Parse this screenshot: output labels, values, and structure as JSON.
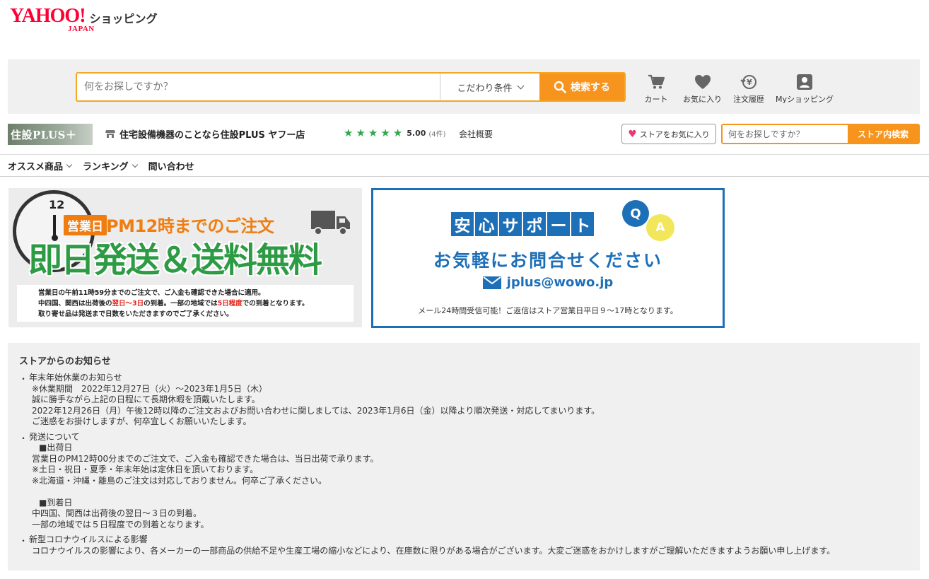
{
  "header": {
    "logo_main": "YAHOO!",
    "logo_sub": "JAPAN",
    "logo_shopping": "ショッピング"
  },
  "search": {
    "placeholder": "何をお探しですか？",
    "conditions_label": "こだわり条件",
    "button_label": "検索する"
  },
  "header_icons": [
    {
      "icon": "cart-icon",
      "label": "カート"
    },
    {
      "icon": "heart-icon",
      "label": "お気に入り"
    },
    {
      "icon": "order-history-icon",
      "label": "注文履歴"
    },
    {
      "icon": "user-icon",
      "label": "Myショッピング"
    }
  ],
  "store": {
    "logo_text": "住設PLUS＋",
    "name": "住宅設備機器のことなら住設PLUS ヤフー店",
    "rating": "5.00",
    "review_count": "(4件)",
    "company_link": "会社概要",
    "favorite_label": "ストアをお気に入り",
    "search_placeholder": "何をお探しですか？",
    "search_button": "ストア内検索"
  },
  "nav": {
    "items": [
      {
        "label": "オススメ商品",
        "dropdown": true
      },
      {
        "label": "ランキング",
        "dropdown": true
      },
      {
        "label": "問い合わせ",
        "dropdown": false
      }
    ]
  },
  "banner1": {
    "clock_12": "12",
    "badge": "営業日",
    "headline": "PM12時までのご注文",
    "big": "即日発送＆送料無料",
    "note1": "営業日の午前11時59分までのご注文で、ご入金も確認できた場合に適用。",
    "note2_a": "中四国、関西は出荷後の",
    "note2_b": "翌日～3日",
    "note2_c": "の到着。一部の地域では",
    "note2_d": "5日程度",
    "note2_e": "での到着となります。",
    "note3": "取り寄せ品は発送まで日数をいただきますのでご了承ください。"
  },
  "banner2": {
    "title_chars": [
      "安",
      "心",
      "サ",
      "ポ",
      "ー",
      "ト"
    ],
    "q": "Q",
    "a": "A",
    "subtitle": "お気軽にお問合せください",
    "email": "jplus@wowo.jp",
    "note": "メール24時間受信可能！ご返信はストア営業日平日９～17時となります。"
  },
  "notice": {
    "title": "ストアからのお知らせ",
    "item1": {
      "l1": "年末年始休業のお知らせ",
      "l2": "※休業期間　2022年12月27日（火）～2023年1月5日（木）",
      "l3": "誠に勝手ながら上記の日程にて長期休暇を頂戴いたします。",
      "l4": "2022年12月26日（月）午後12時以降のご注文およびお問い合わせに関しましては、2023年1月6日（金）以降より順次発送・対応してまいります。",
      "l5": "ご迷惑をお掛けしますが、何卒宜しくお願いいたします。"
    },
    "item2": {
      "l1": "発送について",
      "l2": "■出荷日",
      "l3": "営業日のPM12時00分までのご注文で、ご入金も確認できた場合は、当日出荷で承ります。",
      "l4": "※土日・祝日・夏季・年末年始は定休日を頂いております。",
      "l5": "※北海道・沖縄・離島のご注文は対応しておりません。何卒ご了承ください。",
      "l6": "■到着日",
      "l7": "中四国、関西は出荷後の翌日～３日の到着。",
      "l8": "一部の地域では５日程度での到着となります。"
    },
    "item3": {
      "l1": "新型コロナウイルスによる影響",
      "l2": "コロナウイルスの影響により、各メーカーの一部商品の供給不足や生産工場の縮小などにより、在庫数に限りがある場合がございます。大変ご迷惑をおかけしますがご理解いただきますようお願い申し上げます。"
    }
  },
  "colors": {
    "accent": "#f7941d",
    "brand_red": "#ff0033",
    "green": "#2d9b44",
    "blue": "#1d6fb8"
  }
}
